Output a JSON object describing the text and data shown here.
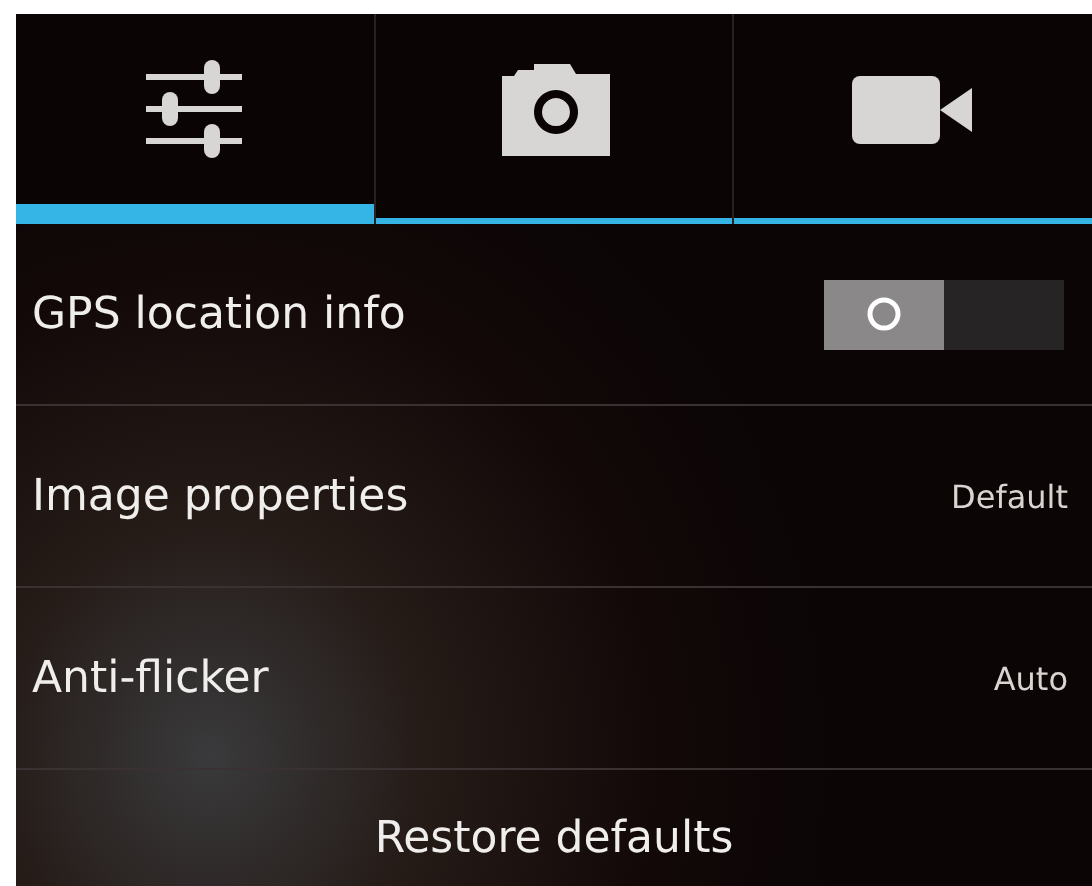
{
  "tabs": [
    {
      "kind": "sliders",
      "selected": true
    },
    {
      "kind": "camera",
      "selected": false
    },
    {
      "kind": "video",
      "selected": false
    }
  ],
  "settings": [
    {
      "kind": "toggle",
      "label": "GPS location info",
      "on": false
    },
    {
      "kind": "value",
      "label": "Image properties",
      "value": "Default"
    },
    {
      "kind": "value",
      "label": "Anti-flicker",
      "value": "Auto"
    }
  ],
  "restore_button": "Restore defaults"
}
